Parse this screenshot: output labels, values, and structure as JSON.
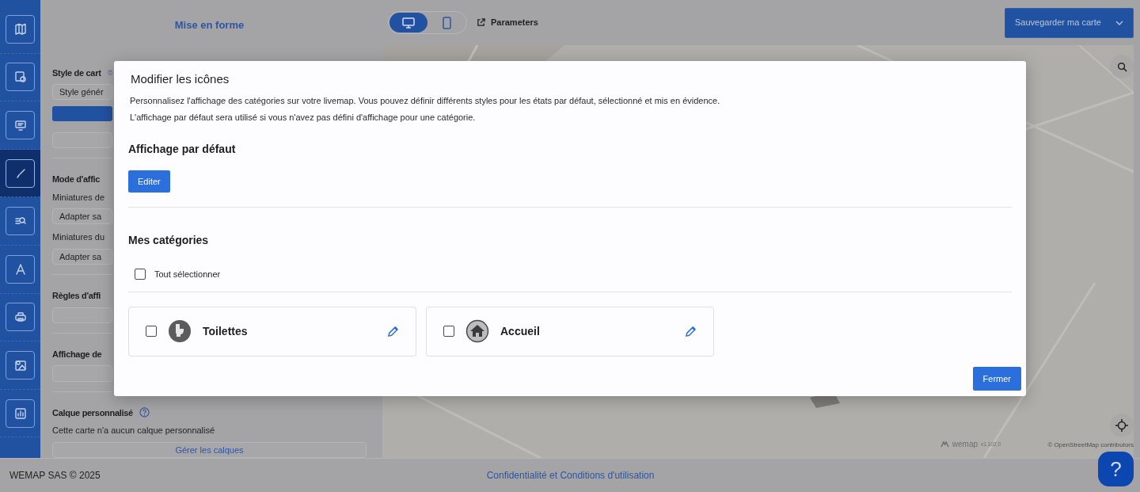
{
  "sidebar": {
    "items": [
      {
        "selected": false
      },
      {
        "selected": false
      },
      {
        "selected": false
      },
      {
        "selected": true
      },
      {
        "selected": false
      },
      {
        "selected": false
      },
      {
        "selected": false
      },
      {
        "selected": false
      },
      {
        "selected": false
      }
    ]
  },
  "panel": {
    "title": "Mise en forme",
    "sections": [
      {
        "kind": "heading",
        "text": "Style de cart",
        "help": true
      },
      {
        "kind": "field",
        "text": "Style génér"
      },
      {
        "kind": "button"
      },
      {
        "kind": "field"
      },
      {
        "kind": "rule"
      },
      {
        "kind": "heading",
        "text": "Mode d'affic"
      },
      {
        "kind": "label",
        "text": "Miniatures de"
      },
      {
        "kind": "field",
        "text": "Adapter sa"
      },
      {
        "kind": "label",
        "text": "Miniatures du"
      },
      {
        "kind": "field",
        "text": "Adapter sa"
      },
      {
        "kind": "rule"
      },
      {
        "kind": "heading",
        "text": "Règles d'affi"
      },
      {
        "kind": "field"
      },
      {
        "kind": "rule"
      },
      {
        "kind": "heading",
        "text": "Affichage de"
      },
      {
        "kind": "field"
      },
      {
        "kind": "rule"
      },
      {
        "kind": "heading",
        "text": "Calque personnalisé",
        "help": true
      },
      {
        "kind": "label",
        "text": "Cette carte n'a aucun calque personnalisé"
      },
      {
        "kind": "link-button",
        "text": "Gérer les calques"
      }
    ]
  },
  "toolbar": {
    "devices": [
      {
        "selected": true
      },
      {
        "selected": false
      }
    ],
    "parameters": "Parameters",
    "save": "Sauvegarder ma carte"
  },
  "map": {
    "brand": "wemap",
    "version": "v1.102.0",
    "attribution": "© OpenStreetMap contributors"
  },
  "modal": {
    "title": "Modifier les icônes",
    "description": [
      "Personnalisez l'affichage des catégories sur votre livemap. Vous pouvez définir différents styles pour les états par défaut, sélectionné et mis en évidence.",
      "L'affichage par défaut sera utilisé si vous n'avez pas défini d'affichage pour une catégorie."
    ],
    "default_heading": "Affichage par défaut",
    "edit_button": "Editer",
    "categories_heading": "Mes catégories",
    "select_all": {
      "label": "Tout sélectionner",
      "checked": false
    },
    "categories": [
      {
        "name": "Toilettes",
        "checked": false
      },
      {
        "name": "Accueil",
        "checked": false
      }
    ],
    "close_button": "Fermer"
  },
  "footer": {
    "copyright": "WEMAP SAS © 2025",
    "link": "Confidentialité et Conditions d'utilisation"
  },
  "help_button": "?"
}
